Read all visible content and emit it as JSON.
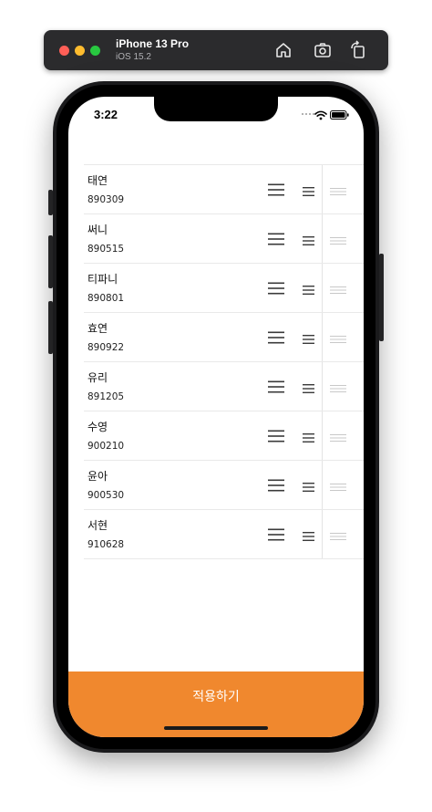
{
  "simulator": {
    "device_name": "iPhone 13 Pro",
    "os_version": "iOS 15.2",
    "icons": [
      "home-icon",
      "screenshot-icon",
      "rotate-icon"
    ]
  },
  "status_bar": {
    "time": "3:22",
    "icons": [
      "signal-dots-icon",
      "wifi-icon",
      "battery-icon"
    ]
  },
  "list": {
    "rows": [
      {
        "name": "태연",
        "number": "890309"
      },
      {
        "name": "써니",
        "number": "890515"
      },
      {
        "name": "티파니",
        "number": "890801"
      },
      {
        "name": "효연",
        "number": "890922"
      },
      {
        "name": "유리",
        "number": "891205"
      },
      {
        "name": "수영",
        "number": "900210"
      },
      {
        "name": "윤아",
        "number": "900530"
      },
      {
        "name": "서현",
        "number": "910628"
      }
    ],
    "row_icons": [
      "menu-large-icon",
      "menu-small-icon",
      "drag-handle-icon"
    ]
  },
  "footer": {
    "apply_label": "적용하기"
  },
  "colors": {
    "accent": "#f0882e",
    "toolbar": "#2b2b2d",
    "divider": "#e9e9e9"
  }
}
